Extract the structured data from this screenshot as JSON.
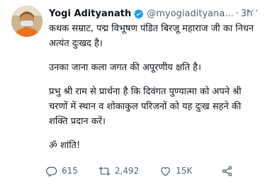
{
  "tweet": {
    "display_name": "Yogi Adityanath",
    "handle": "@myogiadityana...",
    "separator": "·",
    "time": "3h",
    "more_label": "···",
    "paragraphs": [
      "कथक सम्राट, पद्म विभूषण पंडित बिरजू महाराज जी का निधन अत्यंत दुःखद है।",
      "उनका जाना कला जगत की अपूरणीय क्षति है।",
      "प्रभु श्री राम से प्रार्थना है कि दिवंगत पुण्यात्मा को अपने श्री चरणों में स्थान व शोकाकुल परिजनों को यह दुःख सहने की शक्ति प्रदान करें।",
      "ॐ शांति!"
    ],
    "actions": {
      "replies": "615",
      "retweets": "2,492",
      "likes": "15K"
    }
  },
  "icons": {
    "verified": "verified-badge-icon",
    "more": "more-options-icon",
    "reply": "reply-icon",
    "retweet": "retweet-icon",
    "like": "heart-icon",
    "share": "share-icon"
  },
  "colors": {
    "text": "#0f1419",
    "muted": "#536471",
    "verified": "#1d9bf0",
    "background": "#ffffff"
  }
}
